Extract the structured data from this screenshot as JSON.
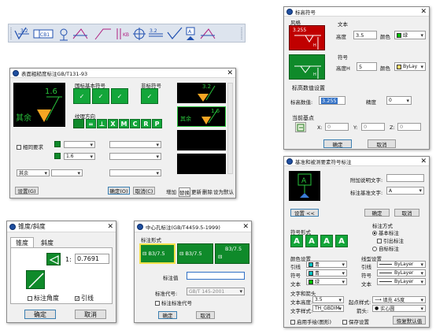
{
  "toolbar": {
    "buttons": [
      "surface-roughness",
      "geometric-tolerance",
      "datum-symbol",
      "welding-symbol",
      "leader",
      "center-mark",
      "hole-tolerance",
      "roughness-tolerance",
      "triangle-datum",
      "datum-target",
      "symbol-extra"
    ],
    "sym_a": "3.2",
    "sym_cb": "CB1",
    "sym_kb": "KB",
    "sym_b": "3.2"
  },
  "bg_dialog": {
    "title": "表面粗糙度标注GB/T131-93",
    "basic_label": "国标基本符号",
    "other_label": "非标符号",
    "texture_label": "纹理方向",
    "texture_buttons": [
      "=",
      "⊥",
      "X",
      "M",
      "C",
      "R",
      "P"
    ],
    "preview_value": "1.6",
    "preview_remark": "其余",
    "preview_value_right": "1.6",
    "preview_top_value": "3.2",
    "check_label": "相同要求",
    "combo_value": "1.6",
    "combo_other": "其余",
    "settings_button": "设置(G)",
    "ok_button": "确定(O)",
    "cancel_button": "取消(C)",
    "add_button": "增加",
    "replace_button": "替换",
    "update_button": "更新",
    "delete_button": "删除",
    "default_button": "设为默认"
  },
  "roughness_dialog": {
    "title": "标高符号",
    "style_label": "风格",
    "style_value": "3.255",
    "text_label": "文本",
    "height_label": "高度",
    "height_value": "3.5",
    "color_label": "颜色",
    "color_value": "绿",
    "color_hex": "#00c000",
    "symbol_label": "符号",
    "symbol_height_label": "高度H",
    "symbol_height_value": "5",
    "symbol_color_label": "颜色",
    "symbol_color_value": "ByLay",
    "symbol_color_hex": "#ffd966",
    "setting_title": "标高数值设置",
    "value_label": "标高数值:",
    "value_value": "3.255",
    "precision_label": "精度",
    "precision_value": "0",
    "point_title": "当前基点",
    "x_label": "X:",
    "x_value": "0",
    "y_label": "Y:",
    "y_value": "0",
    "z_label": "Z:",
    "z_value": "0",
    "ok_button": "确定",
    "cancel_button": "取消"
  },
  "datum_dialog": {
    "title": "基准和被测要素符号标注",
    "datum_letter": "A",
    "extra_text_label": "附加说明文字:",
    "datum_text_label": "标注基准文字:",
    "datum_text_value": "A",
    "setting_button": "设置 <<",
    "ok_button": "确定",
    "cancel_button": "取消",
    "shape_label": "符号形式",
    "shape_letters": [
      "A",
      "A",
      "A",
      "A"
    ],
    "mode_label": "标注方式",
    "mode_options": [
      "基本标注",
      "引出标注",
      "自标标注"
    ],
    "color_label": "颜色设置",
    "color_rows": [
      {
        "label": "引线",
        "value": "青",
        "hex": "#00c0c0"
      },
      {
        "label": "符号",
        "value": "青",
        "hex": "#00c0c0"
      },
      {
        "label": "文本",
        "value": "绿",
        "hex": "#00c000"
      }
    ],
    "linetype_label": "线型设置",
    "linetype_rows": [
      {
        "label": "引线",
        "value": "ByLayer"
      },
      {
        "label": "符号",
        "value": "ByLayer"
      },
      {
        "label": "文本",
        "value": "ByLayer"
      }
    ],
    "text_arrow_label": "文字和箭头",
    "text_height_label": "文本高度:",
    "text_height_value": "3.5",
    "arrow_label": "起点样式:",
    "arrow_value": "填充 45度",
    "text_style_label": "文字样式:",
    "text_style_value": "TH_GBDIM",
    "arrow2_label": "箭头:",
    "arrow2_value": "实心圆",
    "check1": "启用手绘(图形)",
    "check2": "保存设置",
    "reset_button": "恢复默认值"
  },
  "cone_dialog": {
    "title": "锥度/斜度",
    "tab_cone": "锥度",
    "tab_slope": "斜度",
    "ratio_prefix": "1:",
    "ratio_value": "0.7691",
    "check_angle": "标注角度",
    "check_leader": "引线",
    "ok_button": "确定",
    "cancel_button": "取消"
  },
  "center_dialog": {
    "title": "中心孔标注(GB/T4459.5-1999)",
    "form_label": "标注形式",
    "form_text": "B3/7.5",
    "std_label": "标注值",
    "code_label": "标准代号:",
    "code_value": "GB/T 145-2001",
    "check_code": "标注标准代号",
    "ok_button": "确定",
    "cancel_button": "取消"
  }
}
